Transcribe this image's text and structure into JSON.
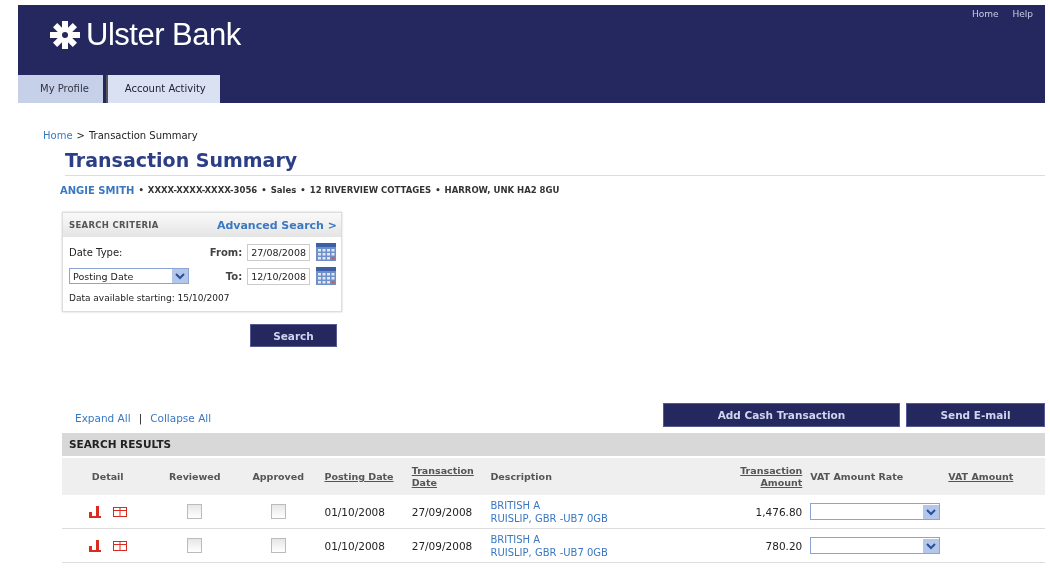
{
  "header": {
    "logo": "Ulster Bank",
    "top_links": [
      "Home",
      "Help"
    ]
  },
  "tabs": [
    {
      "label": "My Profile",
      "selected": false
    },
    {
      "label": "Account Activity",
      "selected": true
    }
  ],
  "breadcrumb": {
    "link": "Home",
    "separator": ">",
    "current": "Transaction Summary"
  },
  "title": "Transaction Summary",
  "account": {
    "name": "ANGIE SMITH",
    "separator": "•",
    "details": [
      "XXXX-XXXX-XXXX-3056",
      "Sales",
      "12 RIVERVIEW COTTAGES",
      "HARROW, UNK HA2 8GU"
    ]
  },
  "search_criteria": {
    "heading": "SEARCH CRITERIA",
    "advanced_link": "Advanced Search >",
    "date_type_label": "Date Type:",
    "date_type_value": "Posting Date",
    "from_label": "From:",
    "from_value": "27/08/2008",
    "to_label": "To:",
    "to_value": "12/10/2008",
    "note": "Data available starting: 15/10/2007",
    "button": "Search"
  },
  "actions": {
    "expand": "Expand All",
    "divider": "|",
    "collapse": "Collapse All",
    "buttons": [
      "Add Cash Transaction",
      "Send E-mail"
    ]
  },
  "results": {
    "heading": "SEARCH RESULTS",
    "columns": [
      {
        "label": "Detail",
        "sortable": false
      },
      {
        "label": "Reviewed",
        "sortable": false
      },
      {
        "label": "Approved",
        "sortable": false
      },
      {
        "label": "Posting Date",
        "sortable": true
      },
      {
        "label": "Transaction Date",
        "sortable": true
      },
      {
        "label": "Description",
        "sortable": false
      },
      {
        "label": "Transaction Amount",
        "sortable": true
      },
      {
        "label": "VAT Amount Rate",
        "sortable": false
      },
      {
        "label": "VAT Amount",
        "sortable": true
      }
    ],
    "rows": [
      {
        "reviewed": false,
        "approved": false,
        "posting_date": "01/10/2008",
        "transaction_date": "27/09/2008",
        "description": [
          "BRITISH A",
          "RUISLIP, GBR -UB7 0GB"
        ],
        "amount": "1,476.80"
      },
      {
        "reviewed": false,
        "approved": false,
        "posting_date": "01/10/2008",
        "transaction_date": "27/09/2008",
        "description": [
          "BRITISH A",
          "RUISLIP, GBR -UB7 0GB"
        ],
        "amount": "780.20"
      }
    ]
  }
}
